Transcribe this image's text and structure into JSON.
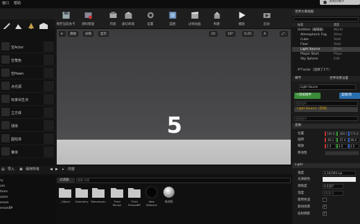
{
  "menu": {
    "items": [
      "窗口",
      "帮助"
    ],
    "ribbon_text": "消失的细节"
  },
  "toolbar": {
    "buttons": [
      {
        "label": "保存当前关卡",
        "icon": "save-icon"
      },
      {
        "label": "源码管理",
        "icon": "source-control-icon"
      },
      {
        "label": "内容",
        "icon": "content-icon"
      },
      {
        "label": "虚幻商城",
        "icon": "marketplace-icon"
      },
      {
        "label": "设置",
        "icon": "settings-icon"
      },
      {
        "label": "蓝图",
        "icon": "blueprint-icon"
      },
      {
        "label": "过场动画",
        "icon": "cinematics-icon"
      },
      {
        "label": "构建",
        "icon": "build-icon"
      },
      {
        "label": "播放",
        "icon": "play-icon"
      },
      {
        "label": "启动",
        "icon": "launch-icon"
      }
    ]
  },
  "place_actors": {
    "items": [
      "空Actor",
      "空角色",
      "空Pawn",
      "点光源",
      "玩家出生点",
      "立方体",
      "球体",
      "圆柱体",
      "锥体"
    ]
  },
  "viewport": {
    "mode_left": "透视",
    "mode_lit": "光照",
    "mode_show": "显示",
    "grid_value": "10",
    "rot_value": "10°",
    "scale_value": "0.25",
    "cam_value": "4",
    "overlay_number": "5"
  },
  "outliner": {
    "title": "世界大纲视图",
    "col_label": "标签",
    "col_type": "类型",
    "rows": [
      {
        "name": "Untitled（编辑器）",
        "type": "World"
      },
      {
        "name": "Atmospheric Fog",
        "type": "Atmo"
      },
      {
        "name": "Cube",
        "type": "Stati"
      },
      {
        "name": "Floor",
        "type": "Stati"
      },
      {
        "name": "Light Source",
        "type": "Direc"
      },
      {
        "name": "Player Start",
        "type": "Playe"
      },
      {
        "name": "Sky Sphere",
        "type": "Edit"
      }
    ],
    "footer": "9个actor（选择了1个）"
  },
  "details": {
    "tab_details": "细节",
    "tab_world": "世界场景设置",
    "name_value": "Light Source",
    "add_component": "+添加组件",
    "blueprint_button": "蓝图/添",
    "search_placeholder": "搜索组件",
    "component_item": "Light Source（实例）",
    "search_details": "搜索细节",
    "transform_section": "变换",
    "location_label": "位置",
    "rotation_label": "旋转",
    "scale_label": "缩放",
    "location": [
      "100.0",
      "-200.0",
      "570.0"
    ],
    "rotation": [
      "-93.1",
      "-37.4",
      "36.4"
    ],
    "scale": [
      "2.5",
      "2.5",
      "2.5"
    ],
    "mobility_label": "移动性",
    "light_section": "Light",
    "intensity_label": "强度",
    "intensity_value": "3.141593 lux",
    "light_color_label": "光源颜色",
    "source_angle_label": "源角度",
    "source_angle_value": "0.5357",
    "temperature_label": "温度",
    "temperature_value": "6500.0",
    "use_temp_label": "使用色温",
    "affects_world_label": "影响场景",
    "cast_shadows_label": "投射阴影"
  },
  "content_browser": {
    "import_label": "导入",
    "save_all_label": "保存所有",
    "path_label": "内容",
    "filter_label": "过滤器",
    "search_placeholder": "搜索 内容",
    "tree_items": [
      "ry",
      "om",
      "tions",
      "acter",
      "erson",
      "ersonBP"
    ],
    "assets": [
      "_Object",
      "Geometry",
      "Mannequin",
      "Third Person",
      "Third PersonBP",
      "New Material",
      "新材质"
    ]
  },
  "colors": {
    "accent": "#e0a000",
    "selection": "#3b3b3b",
    "green": "#4caf50",
    "blue": "#2a8fd6"
  }
}
